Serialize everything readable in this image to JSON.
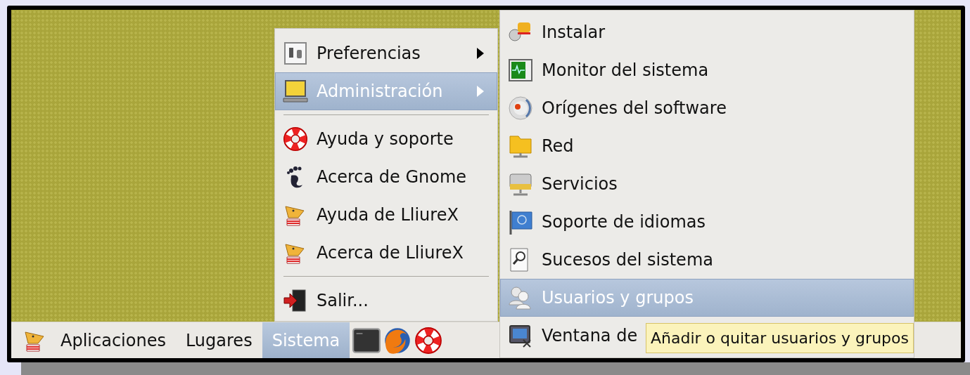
{
  "panel": {
    "menus": [
      {
        "label": "Aplicaciones",
        "selected": false
      },
      {
        "label": "Lugares",
        "selected": false
      },
      {
        "label": "Sistema",
        "selected": true
      }
    ]
  },
  "system_menu": {
    "items": [
      {
        "kind": "item",
        "label": "Preferencias",
        "has_submenu": true,
        "selected": false
      },
      {
        "kind": "item",
        "label": "Administración",
        "has_submenu": true,
        "selected": true
      },
      {
        "kind": "separator"
      },
      {
        "kind": "item",
        "label": "Ayuda y soporte",
        "has_submenu": false,
        "selected": false
      },
      {
        "kind": "item",
        "label": "Acerca de Gnome",
        "has_submenu": false,
        "selected": false
      },
      {
        "kind": "item",
        "label": "Ayuda de LliureX",
        "has_submenu": false,
        "selected": false
      },
      {
        "kind": "item",
        "label": "Acerca de LliureX",
        "has_submenu": false,
        "selected": false
      },
      {
        "kind": "separator"
      },
      {
        "kind": "item",
        "label": "Salir...",
        "has_submenu": false,
        "selected": false
      }
    ]
  },
  "admin_submenu": {
    "items": [
      {
        "label": "Instalar",
        "selected": false
      },
      {
        "label": "Monitor del sistema",
        "selected": false
      },
      {
        "label": "Orígenes del software",
        "selected": false
      },
      {
        "label": "Red",
        "selected": false
      },
      {
        "label": "Servicios",
        "selected": false
      },
      {
        "label": "Soporte de idiomas",
        "selected": false
      },
      {
        "label": "Sucesos del sistema",
        "selected": false
      },
      {
        "label": "Usuarios y grupos",
        "selected": true
      },
      {
        "label": "Ventana de",
        "selected": false
      }
    ]
  },
  "tooltip": {
    "text": "Añadir o quitar usuarios y grupos"
  }
}
